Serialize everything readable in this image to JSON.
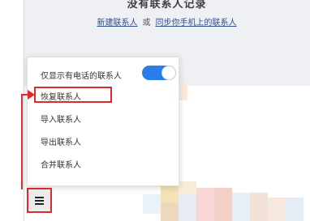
{
  "empty_state": {
    "title": "没有联系人记录",
    "link_new": "新建联系人",
    "or_text": "或",
    "link_sync": "同步你手机上的联系人"
  },
  "menu": {
    "items": [
      {
        "label": "仅显示有电话的联系人"
      },
      {
        "label": "恢复联系人"
      },
      {
        "label": "导入联系人"
      },
      {
        "label": "导出联系人"
      },
      {
        "label": "合并联系人"
      }
    ],
    "toggle_on": true
  },
  "menu_button": {
    "icon": "hamburger-menu-icon"
  },
  "colors": {
    "accent": "#2b7de9",
    "highlight": "#e0292c",
    "panel_bg": "#eef0f4"
  }
}
